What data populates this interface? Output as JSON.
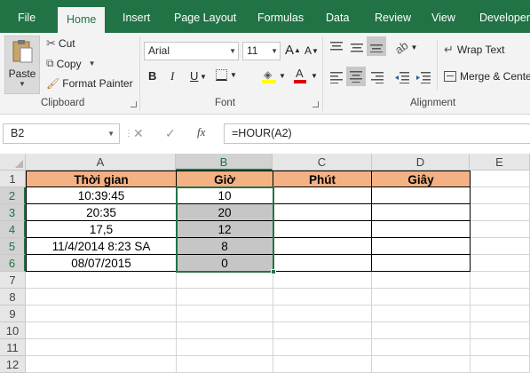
{
  "tabs": [
    "File",
    "Home",
    "Insert",
    "Page Layout",
    "Formulas",
    "Data",
    "Review",
    "View",
    "Developer"
  ],
  "active_tab": "Home",
  "clipboard": {
    "paste": "Paste",
    "cut": "Cut",
    "copy": "Copy",
    "format_painter": "Format Painter",
    "label": "Clipboard"
  },
  "font": {
    "name": "Arial",
    "size": "11",
    "bold": "B",
    "italic": "I",
    "underline": "U",
    "label": "Font"
  },
  "alignment": {
    "wrap_text": "Wrap Text",
    "merge": "Merge & Center",
    "label": "Alignment"
  },
  "formula_bar": {
    "name_box": "B2",
    "cancel": "✕",
    "enter": "✓",
    "fx": "fx",
    "formula": "=HOUR(A2)"
  },
  "columns": [
    "A",
    "B",
    "C",
    "D",
    "E"
  ],
  "rows": [
    "1",
    "2",
    "3",
    "4",
    "5",
    "6",
    "7",
    "8",
    "9",
    "10",
    "11",
    "12"
  ],
  "table": {
    "headers": [
      "Thời gian",
      "Giờ",
      "Phút",
      "Giây"
    ],
    "rows": [
      [
        "10:39:45",
        "10",
        "",
        ""
      ],
      [
        "20:35",
        "20",
        "",
        ""
      ],
      [
        "17,5",
        "12",
        "",
        ""
      ],
      [
        "11/4/2014 8:23 SA",
        "8",
        "",
        ""
      ],
      [
        "08/07/2015",
        "0",
        "",
        ""
      ]
    ]
  },
  "colors": {
    "ribbon_tab": "#217346",
    "header_fill": "#f4b183",
    "selection": "#c6c6c6"
  }
}
